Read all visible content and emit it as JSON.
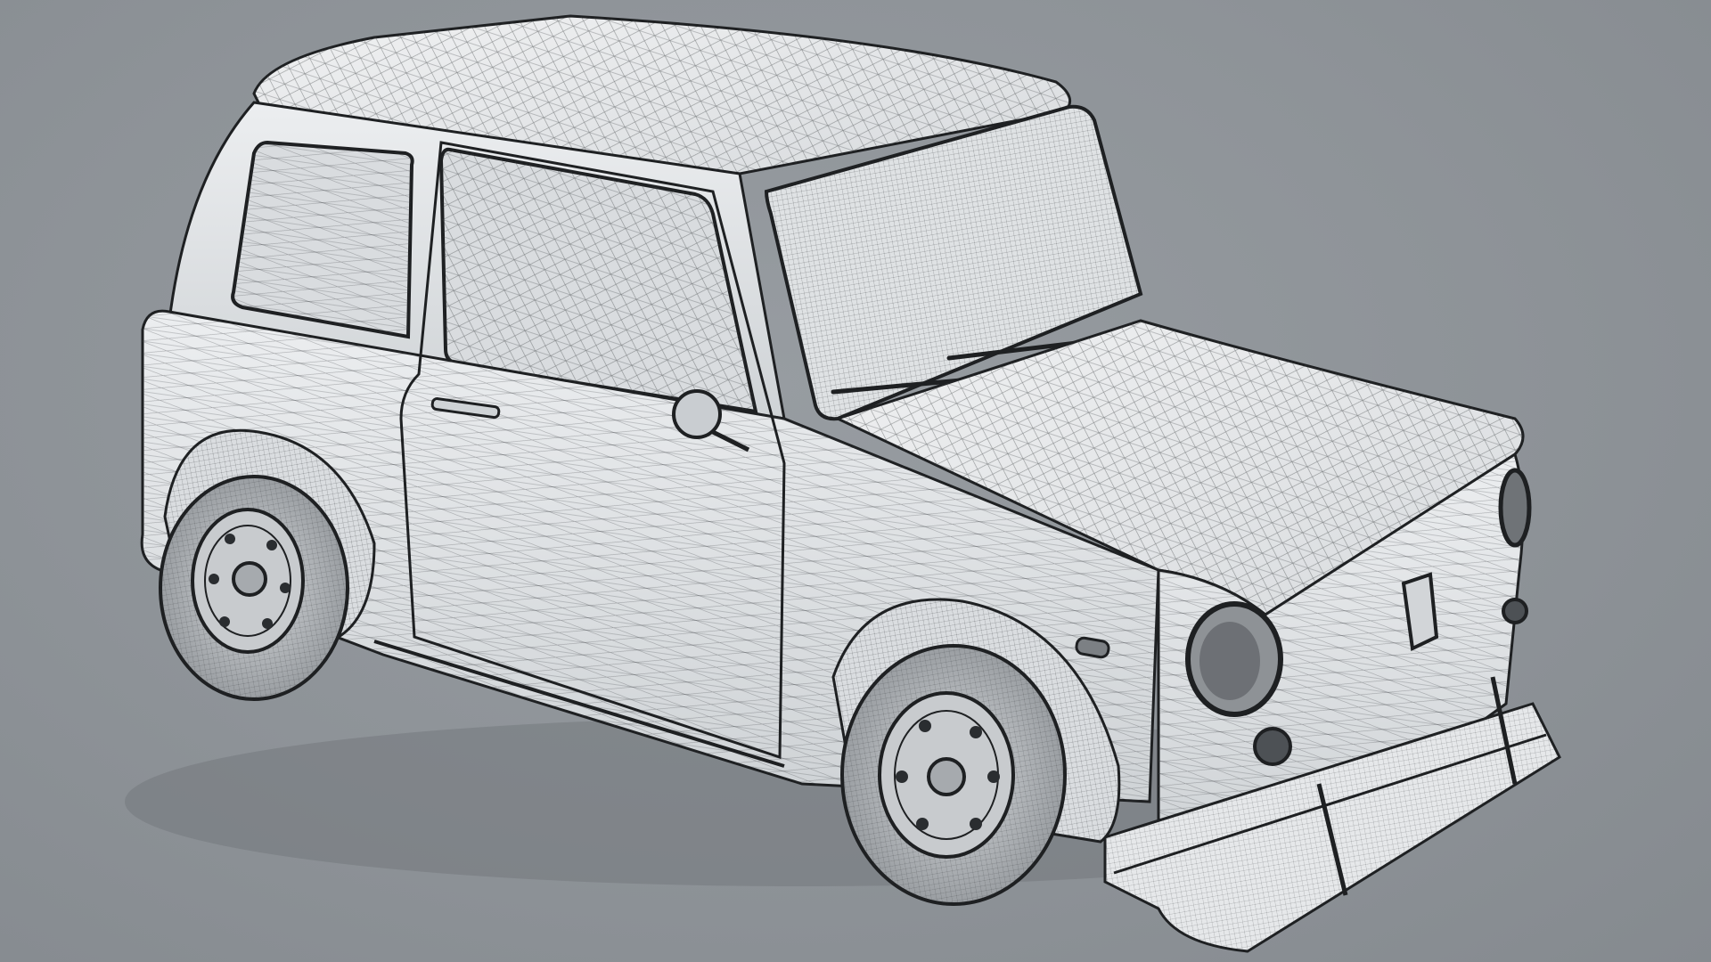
{
  "scene": {
    "subject": "car",
    "render_style": "wireframe-shaded",
    "colors": {
      "background": "#8d9398",
      "body": "#e4e6e8",
      "body_shadow": "#c9cdd1",
      "glass": "#d9dcdf",
      "wire": "#3a3d40",
      "outline": "#1e2022",
      "tire": "#bfc3c7",
      "floor_shadow": "#6f7478"
    }
  }
}
